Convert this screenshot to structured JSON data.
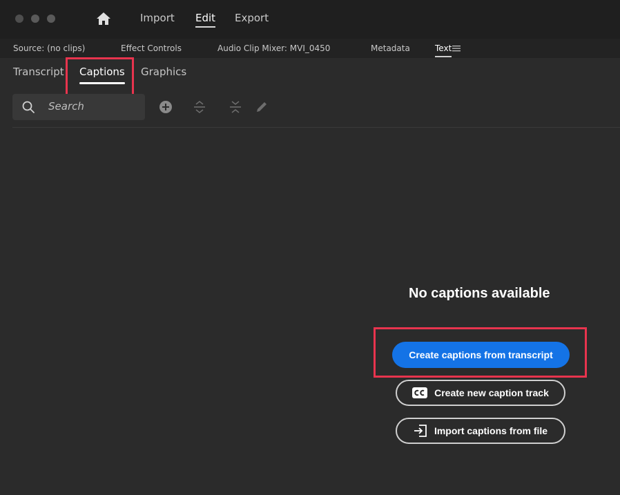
{
  "titlebar": {
    "menu": [
      {
        "label": "Import"
      },
      {
        "label": "Edit"
      },
      {
        "label": "Export"
      }
    ]
  },
  "panels": {
    "tabs": [
      {
        "label": "Source: (no clips)"
      },
      {
        "label": "Effect Controls"
      },
      {
        "label": "Audio Clip Mixer: MVI_0450"
      },
      {
        "label": "Metadata"
      },
      {
        "label": "Text"
      }
    ]
  },
  "text_panel": {
    "subtabs": [
      {
        "label": "Transcript"
      },
      {
        "label": "Captions"
      },
      {
        "label": "Graphics"
      }
    ],
    "search": {
      "placeholder": "Search"
    },
    "empty_state": {
      "title": "No captions available",
      "primary_button": "Create captions from transcript",
      "new_track_button": "Create new caption track",
      "import_button": "Import captions from file"
    }
  },
  "colors": {
    "accent": "#1473e6",
    "highlight": "#e8344e",
    "background": "#2b2b2b"
  },
  "icons": [
    "home-icon",
    "search-icon",
    "add-icon",
    "expand-icon",
    "collapse-icon",
    "edit-icon",
    "cc-icon",
    "import-icon",
    "menu-icon"
  ]
}
